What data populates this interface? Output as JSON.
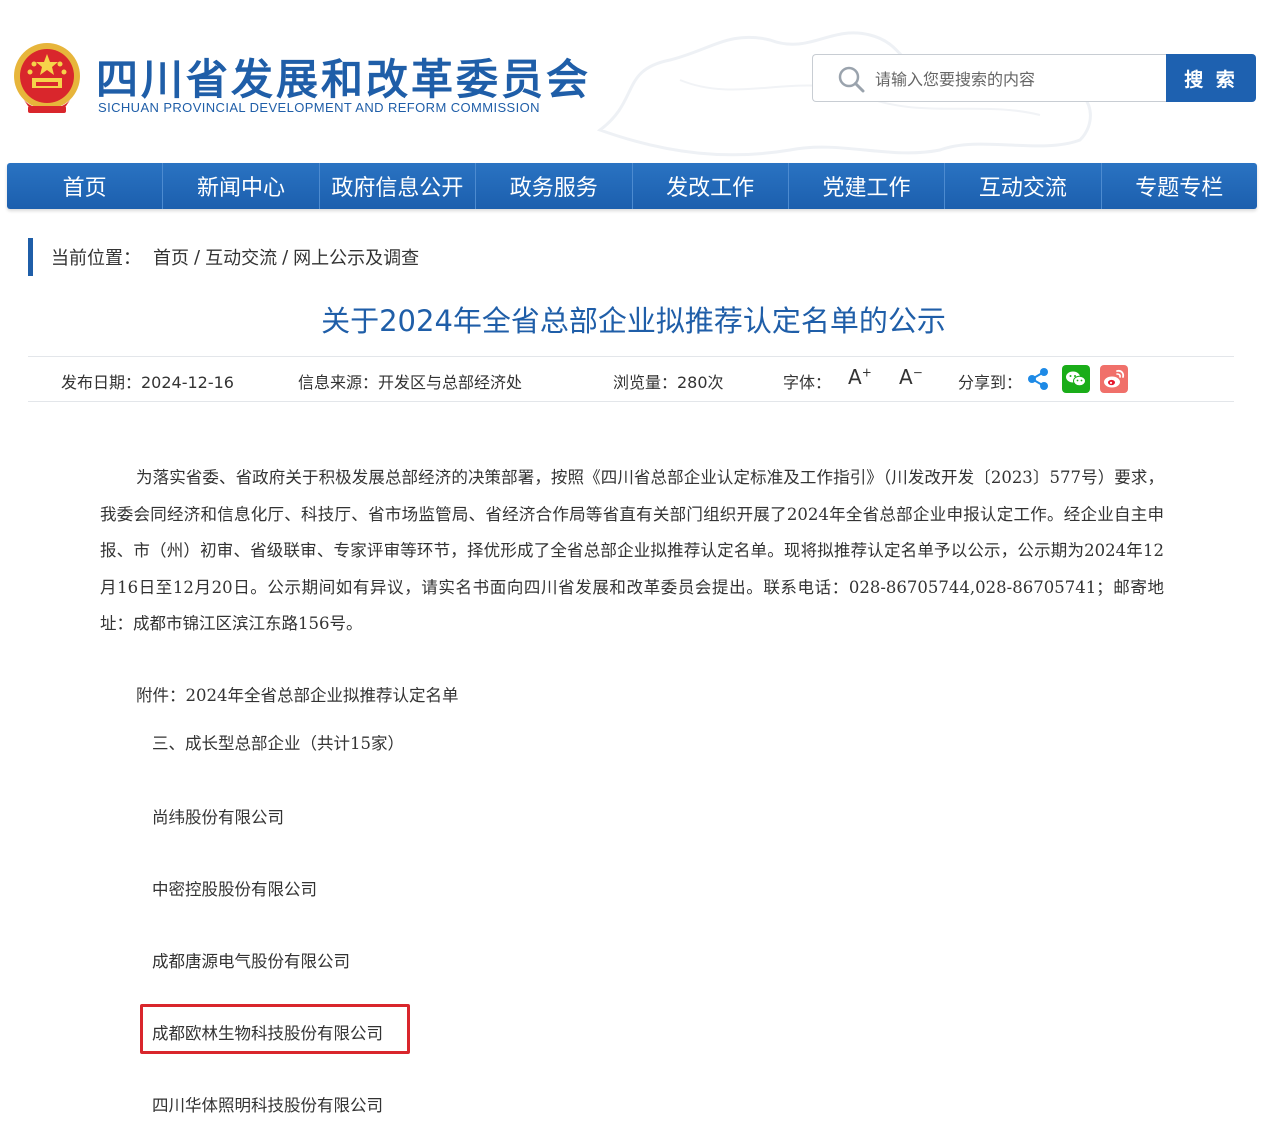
{
  "header": {
    "title_cn": "四川省发展和改革委员会",
    "title_en": "SICHUAN PROVINCIAL DEVELOPMENT AND REFORM COMMISSION",
    "emblem_icon": "national-emblem-icon",
    "search": {
      "placeholder": "请输入您要搜索的内容",
      "button_label": "搜 索"
    }
  },
  "nav": {
    "items": [
      {
        "label": "首页"
      },
      {
        "label": "新闻中心"
      },
      {
        "label": "政府信息公开"
      },
      {
        "label": "政务服务"
      },
      {
        "label": "发改工作"
      },
      {
        "label": "党建工作"
      },
      {
        "label": "互动交流"
      },
      {
        "label": "专题专栏"
      }
    ]
  },
  "breadcrumb": {
    "prefix": "当前位置：",
    "items": [
      "首页",
      "互动交流",
      "网上公示及调查"
    ],
    "separator": "/"
  },
  "article": {
    "title": "关于2024年全省总部企业拟推荐认定名单的公示",
    "meta": {
      "date": "发布日期：2024-12-16",
      "source": "信息来源：开发区与总部经济处",
      "views": "浏览量：280次",
      "font_label": "字体：",
      "font_increase": "A",
      "font_decrease": "A",
      "share_label": "分享到："
    },
    "body": "为落实省委、省政府关于积极发展总部经济的决策部署，按照《四川省总部企业认定标准及工作指引》（川发改开发〔2023〕577号）要求，我委会同经济和信息化厅、科技厅、省市场监管局、省经济合作局等省直有关部门组织开展了2024年全省总部企业申报认定工作。经企业自主申报、市（州）初审、省级联审、专家评审等环节，择优形成了全省总部企业拟推荐认定名单。现将拟推荐认定名单予以公示，公示期为2024年12月16日至12月20日。公示期间如有异议，请实名书面向四川省发展和改革委员会提出。联系电话：028-86705744,028-86705741；邮寄地址：成都市锦江区滨江东路156号。",
    "attachment": "附件：2024年全省总部企业拟推荐认定名单",
    "section_heading": "三、成长型总部企业（共计15家）",
    "companies": [
      "尚纬股份有限公司",
      "中密控股股份有限公司",
      "成都唐源电气股份有限公司",
      "成都欧林生物科技股份有限公司",
      "四川华体照明科技股份有限公司"
    ],
    "highlighted_company_index": 3
  },
  "colors": {
    "brand_blue": "#1f5ea8",
    "nav_blue": "#1e61b0",
    "highlight_red": "#d9262c",
    "wechat_green": "#1aad19",
    "weibo_red": "#e6162d"
  }
}
